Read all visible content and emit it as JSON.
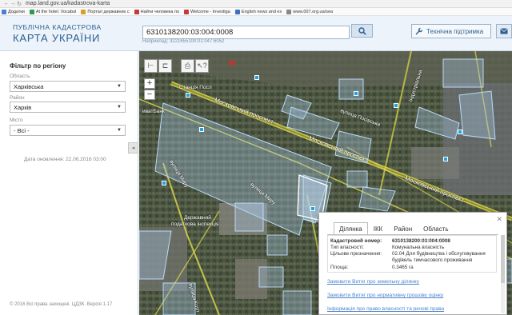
{
  "browser": {
    "url": "map.land.gov.ua/kadastrova-karta",
    "bookmarks": [
      "Додатки",
      "At the hotel. Vocabul",
      "Портал державних с",
      "Найти человека по",
      "Welcome - Investiga",
      "English news and ex",
      "www.007.org.ua/sea"
    ]
  },
  "header": {
    "logo_small": "ПУБЛІЧНА КАДАСТРОВА",
    "logo_big": "КАРТА УКРАЇНИ",
    "search_value": "6310138200:03:004:0008",
    "search_hint": "Наприклад: 3221655100:01:047:6052",
    "support_label": "Технічна підтримка"
  },
  "sidebar": {
    "filter_title": "Фільтр по регіону",
    "region_label": "Область",
    "region_value": "Харківська",
    "district_label": "Район",
    "district_value": "Харків",
    "city_label": "Місто",
    "city_value": "- Всі -",
    "update_date": "Дата оновлення: 22.06.2016 03:00",
    "copyright": "© 2016 Всі права захищені. ЦДЗК. Версія 1.17"
  },
  "map": {
    "labels": {
      "station": "Станція Посл",
      "bank": "иватБанк",
      "street_moskovsky_1": "Московський проспект",
      "street_moskovsky_2": "Московський проспект",
      "street_moskovsky_3": "Московський проспект",
      "street_posivska": "вулиця Посівська",
      "street_miru": "вулиця Миру",
      "street_miru_2": "вулиця Миру",
      "street_kotl": "вулиця Котл",
      "street_industrialna": "Індустріальна",
      "tax_office_1": "Державний",
      "tax_office_2": "податкова інспекція",
      "metro_icon": "M"
    },
    "poi_icon": "square-poi-icon"
  },
  "popup": {
    "tabs": [
      "Ділянка",
      "ІКК",
      "Район",
      "Область"
    ],
    "active_tab": "Ділянка",
    "rows": [
      {
        "key": "Кадастровий номер:",
        "value": "6310138200:03:004:0008"
      },
      {
        "key": "Тип власності:",
        "value": "Комунальна власність"
      },
      {
        "key": "Цільове призначення:",
        "value": "02.04 Для будівництва і обслуговування будівель тимчасового проживання"
      },
      {
        "key": "Площа:",
        "value": "0.3465 га"
      }
    ],
    "links": [
      "Замовити Витяг про земельну ділянку",
      "Замовити Витяг про нормативну грошову оцінку",
      "Інформація про право власності та речові права"
    ]
  }
}
